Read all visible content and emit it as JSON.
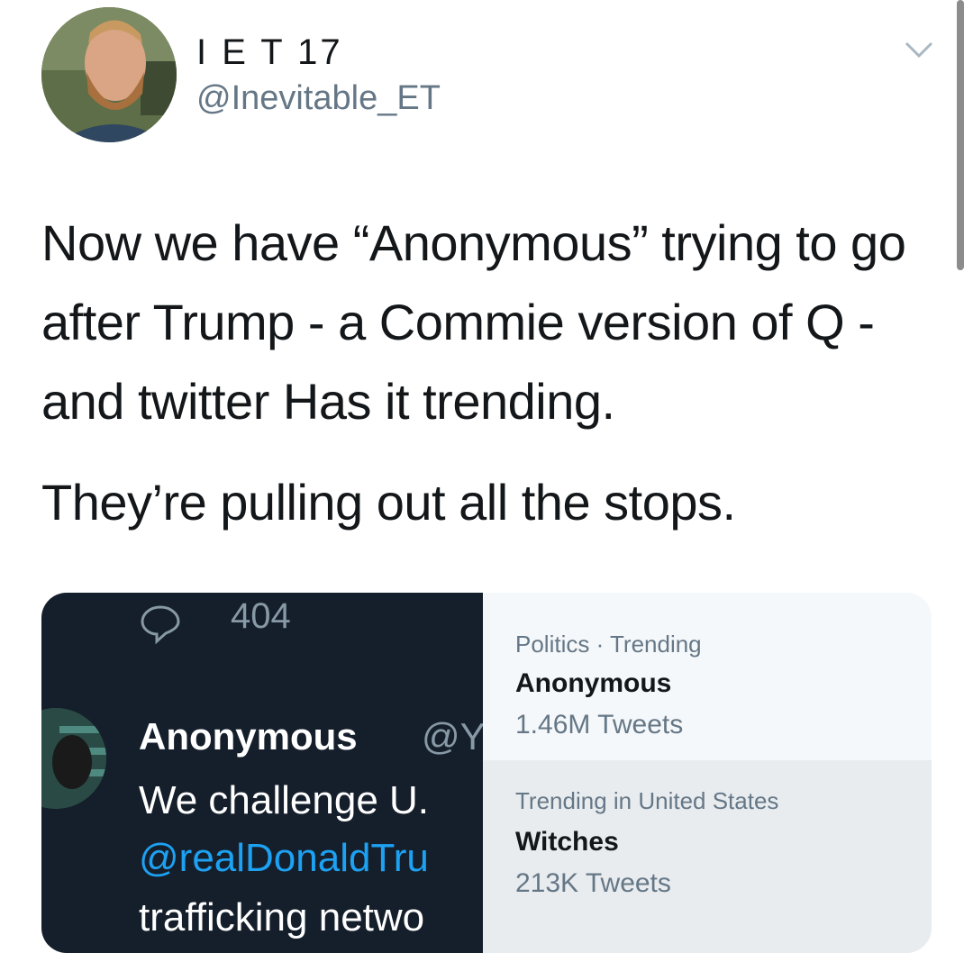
{
  "author": {
    "display_name": "I E T 17",
    "handle": "@Inevitable_ET",
    "avatar_icon": "profile-photo",
    "menu_icon": "chevron-down-icon"
  },
  "tweet": {
    "paragraph_1": "Now we have “Anonymous” trying to go after Trump - a Commie version of Q - and twitter Has it trending.",
    "paragraph_2": "They’re pulling out all the stops."
  },
  "embedded_image": {
    "left_panel": {
      "reply_icon": "reply-bubble-icon",
      "reply_count": "404",
      "name": "Anonymous",
      "handle_fragment": "@Y",
      "text_fragment": "We challenge U.",
      "mention_fragment": "@realDonaldTru",
      "text_fragment_2": "trafficking netwo"
    },
    "trends": [
      {
        "category": "Politics · Trending",
        "name": "Anonymous",
        "count": "1.46M Tweets"
      },
      {
        "category": "Trending in United States",
        "name": "Witches",
        "count": "213K Tweets"
      }
    ]
  },
  "colors": {
    "text": "#14171a",
    "secondary": "#657786",
    "link": "#1da1f2",
    "dark_bg": "#151f2b"
  }
}
